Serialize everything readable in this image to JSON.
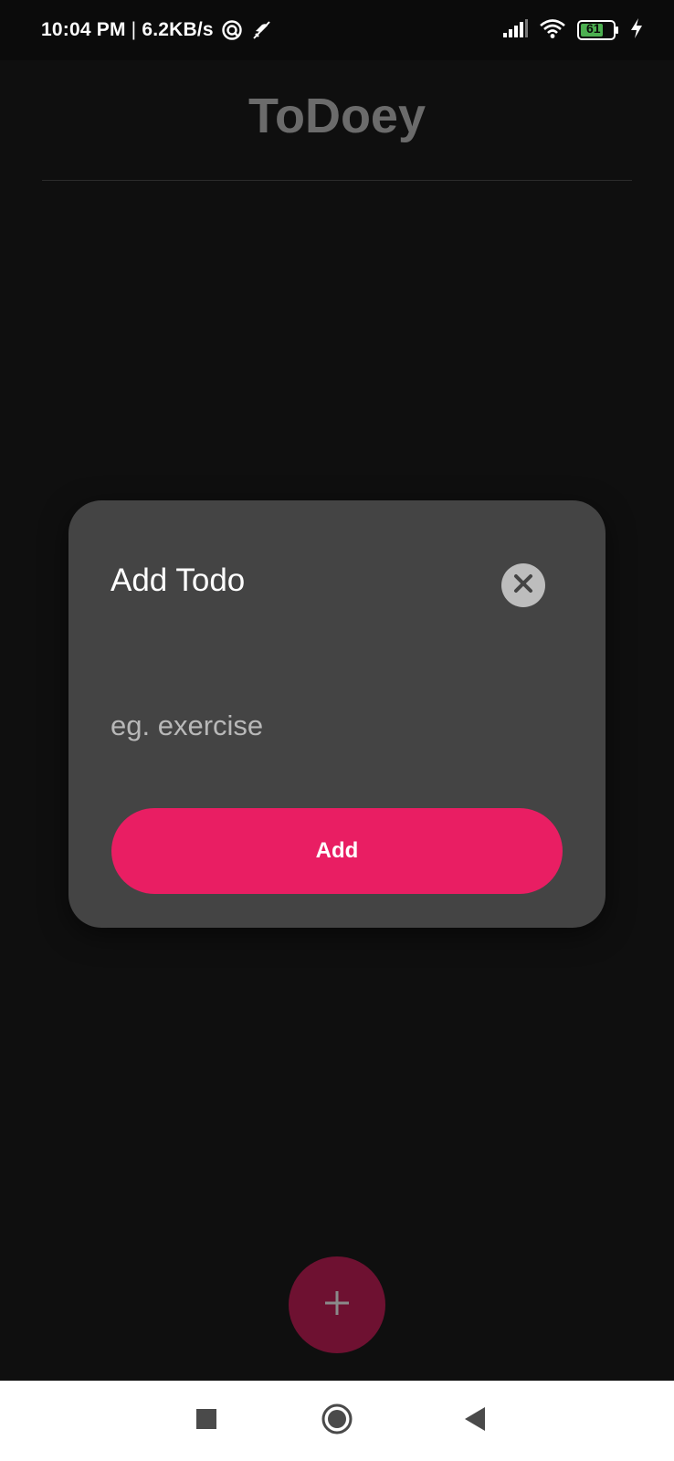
{
  "status_bar": {
    "time": "10:04 PM",
    "separator": "|",
    "network_speed": "6.2KB/s",
    "battery_level": "61",
    "icons": [
      "sync-icon",
      "do-not-disturb-icon",
      "signal-icon",
      "wifi-icon",
      "battery-icon",
      "charging-icon"
    ]
  },
  "app": {
    "title": "ToDoey"
  },
  "dialog": {
    "title": "Add Todo",
    "input_placeholder": "eg. exercise",
    "input_value": "",
    "add_label": "Add"
  },
  "fab": {
    "icon": "plus-icon"
  },
  "nav_bar": {
    "icons": [
      "recents-icon",
      "home-icon",
      "back-icon"
    ]
  },
  "colors": {
    "accent": "#e91e63",
    "background": "#0f0f0f",
    "dialog_background": "#444444",
    "title_color": "#6b6b6b"
  }
}
